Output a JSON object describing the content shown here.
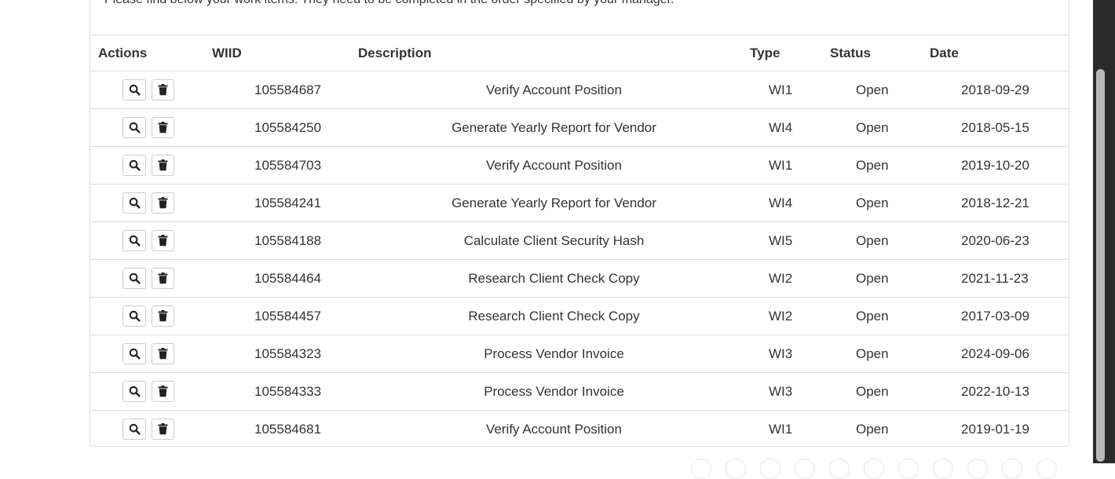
{
  "intro_text": "Please find below your work items. They need to be completed in the order specified by your manager.",
  "columns": [
    "Actions",
    "WIID",
    "Description",
    "Type",
    "Status",
    "Date"
  ],
  "rows": [
    {
      "wiid": "105584687",
      "description": "Verify Account Position",
      "type": "WI1",
      "status": "Open",
      "date": "2018-09-29"
    },
    {
      "wiid": "105584250",
      "description": "Generate Yearly Report for Vendor",
      "type": "WI4",
      "status": "Open",
      "date": "2018-05-15"
    },
    {
      "wiid": "105584703",
      "description": "Verify Account Position",
      "type": "WI1",
      "status": "Open",
      "date": "2019-10-20"
    },
    {
      "wiid": "105584241",
      "description": "Generate Yearly Report for Vendor",
      "type": "WI4",
      "status": "Open",
      "date": "2018-12-21"
    },
    {
      "wiid": "105584188",
      "description": "Calculate Client Security Hash",
      "type": "WI5",
      "status": "Open",
      "date": "2020-06-23"
    },
    {
      "wiid": "105584464",
      "description": "Research Client Check Copy",
      "type": "WI2",
      "status": "Open",
      "date": "2021-11-23"
    },
    {
      "wiid": "105584457",
      "description": "Research Client Check Copy",
      "type": "WI2",
      "status": "Open",
      "date": "2017-03-09"
    },
    {
      "wiid": "105584323",
      "description": "Process Vendor Invoice",
      "type": "WI3",
      "status": "Open",
      "date": "2024-09-06"
    },
    {
      "wiid": "105584333",
      "description": "Process Vendor Invoice",
      "type": "WI3",
      "status": "Open",
      "date": "2022-10-13"
    },
    {
      "wiid": "105584681",
      "description": "Verify Account Position",
      "type": "WI1",
      "status": "Open",
      "date": "2019-01-19"
    }
  ],
  "icons": {
    "view": "search-icon",
    "delete": "trash-icon"
  },
  "colors": {
    "border": "#dddddd",
    "text": "#333333",
    "scrollbar_track": "#2b2b2b",
    "scrollbar_thumb": "#b8b8b8"
  }
}
